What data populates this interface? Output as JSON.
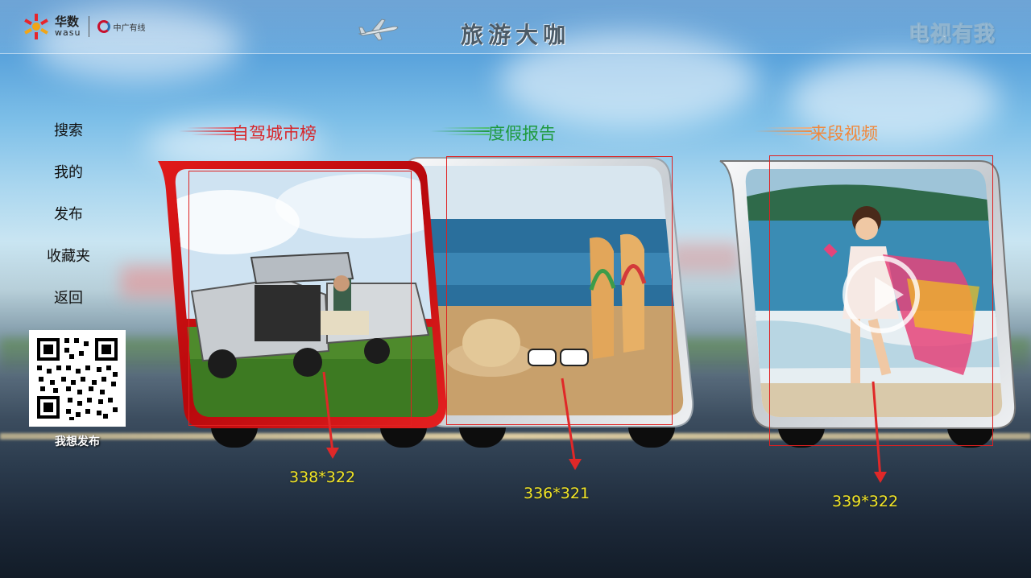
{
  "header": {
    "logo_cn": "华数",
    "logo_en": "wasu",
    "partner": "中广有线",
    "title": "旅游大咖",
    "brand": "电视有我"
  },
  "sidebar": {
    "items": [
      {
        "label": "搜索"
      },
      {
        "label": "我的"
      },
      {
        "label": "发布"
      },
      {
        "label": "收藏夹"
      },
      {
        "label": "返回"
      }
    ],
    "qr_label": "我想发布"
  },
  "sections": [
    {
      "label": "自驾城市榜",
      "color": "#d7262b"
    },
    {
      "label": "度假报告",
      "color": "#1e9a3e"
    },
    {
      "label": "来段视频",
      "color": "#f0883c"
    }
  ],
  "cards": [
    {
      "dimension": "338*322",
      "frame": "red"
    },
    {
      "dimension": "336*321",
      "frame": "silver"
    },
    {
      "dimension": "339*322",
      "frame": "silver"
    }
  ]
}
